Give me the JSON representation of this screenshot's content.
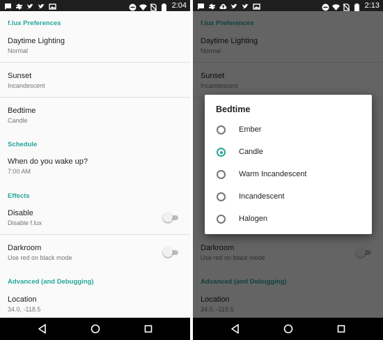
{
  "left_screen": {
    "status_time": "2:04",
    "sections": {
      "flux_preferences": "f.lux Preferences",
      "schedule": "Schedule",
      "effects": "Effects",
      "advanced": "Advanced (and Debugging)"
    },
    "prefs": {
      "daytime_lighting": {
        "title": "Daytime Lighting",
        "summary": "Normal"
      },
      "sunset": {
        "title": "Sunset",
        "summary": "Incandescent"
      },
      "bedtime": {
        "title": "Bedtime",
        "summary": "Candle"
      },
      "wake_up": {
        "title": "When do you wake up?",
        "summary": "7:00 AM"
      },
      "disable": {
        "title": "Disable",
        "summary": "Disable f.lux",
        "enabled": false
      },
      "darkroom": {
        "title": "Darkroom",
        "summary": "Use red on black mode",
        "enabled": false
      },
      "location": {
        "title": "Location",
        "summary": "34.0, -118.5"
      }
    }
  },
  "right_screen": {
    "status_time": "2:13",
    "dialog": {
      "title": "Bedtime",
      "options": [
        "Ember",
        "Candle",
        "Warm Incandescent",
        "Incandescent",
        "Halogen"
      ],
      "selected": "Candle"
    }
  },
  "icons": {
    "status_left": [
      "chat-icon",
      "sync-icon",
      "twitter-icon",
      "cloud-upload-icon",
      "twitter-icon",
      "photos-icon"
    ],
    "status_right": [
      "do-not-disturb-icon",
      "wifi-icon",
      "no-sim-icon",
      "battery-icon"
    ],
    "nav": [
      "back-icon",
      "home-icon",
      "recents-icon"
    ]
  },
  "colors": {
    "accent": "#26a69a",
    "status_bar": "#1e1e1e",
    "nav_bar": "#000000",
    "background": "#fafafa"
  }
}
